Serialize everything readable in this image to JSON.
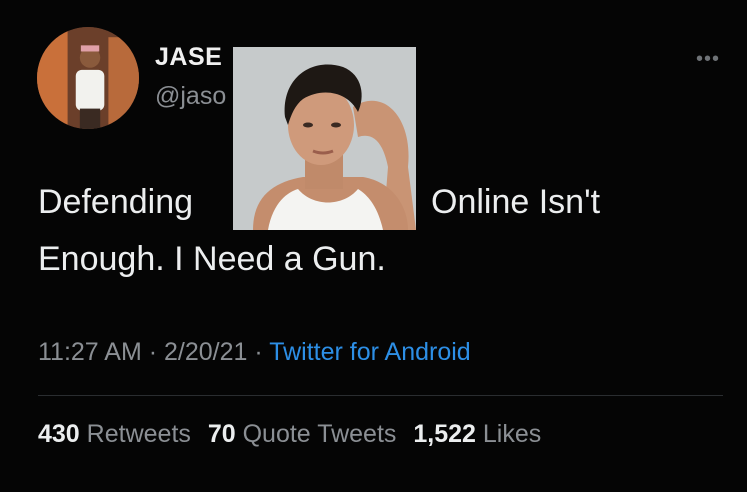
{
  "tweet": {
    "display_name": "JASE",
    "handle": "@jaso",
    "more_icon": "more-horizontal-icon",
    "text_line1_start": "Defending",
    "text_line1_end": "Online Isn't",
    "text_line2": "Enough. I Need a Gun.",
    "time": "11:27 AM",
    "date": "2/20/21",
    "separator": "·",
    "source": "Twitter for Android",
    "source_color": "#2d8fe6"
  },
  "stats": {
    "retweets_count": "430",
    "retweets_label": "Retweets",
    "quote_count": "70",
    "quote_label": "Quote Tweets",
    "likes_count": "1,522",
    "likes_label": "Likes"
  }
}
